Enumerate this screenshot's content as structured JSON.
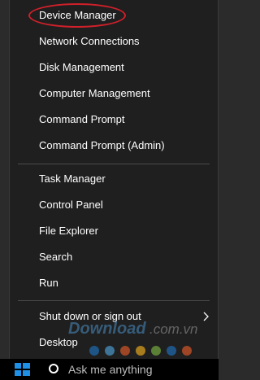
{
  "menu": {
    "items": [
      {
        "label": "Device Manager"
      },
      {
        "label": "Network Connections"
      },
      {
        "label": "Disk Management"
      },
      {
        "label": "Computer Management"
      },
      {
        "label": "Command Prompt"
      },
      {
        "label": "Command Prompt (Admin)"
      },
      {
        "label": "Task Manager"
      },
      {
        "label": "Control Panel"
      },
      {
        "label": "File Explorer"
      },
      {
        "label": "Search"
      },
      {
        "label": "Run"
      },
      {
        "label": "Shut down or sign out"
      },
      {
        "label": "Desktop"
      }
    ]
  },
  "taskbar": {
    "search_placeholder": "Ask me anything"
  },
  "watermark": {
    "text": "Download.com.vn",
    "dot_colors": [
      "#1e73be",
      "#4ea3d8",
      "#e25b2a",
      "#f2b01e",
      "#7cb342",
      "#1e73be",
      "#e25b2a"
    ]
  },
  "colors": {
    "menu_bg": "#1f1f1f",
    "highlight": "#d0202a",
    "taskbar_bg": "#000000",
    "start_icon": "#1e90e8"
  }
}
